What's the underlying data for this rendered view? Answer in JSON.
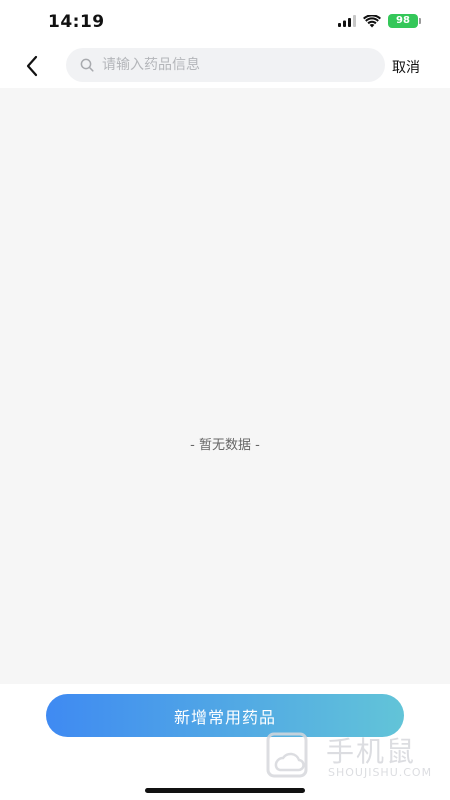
{
  "status_bar": {
    "time": "14:19",
    "battery_level": "98",
    "battery_color": "#34c759"
  },
  "search": {
    "placeholder": "请输入药品信息",
    "value": "",
    "cancel_label": "取消"
  },
  "icons": {
    "back": "chevron-left-icon",
    "search": "search-icon",
    "signal": "cellular-signal-icon",
    "wifi": "wifi-icon",
    "battery": "battery-charging-icon"
  },
  "content": {
    "empty_text": "- 暂无数据 -"
  },
  "bottom": {
    "add_button_label": "新增常用药品",
    "accent_gradient": [
      "#3f8af2",
      "#62c4d8"
    ]
  },
  "watermark": {
    "main": "手机鼠",
    "sub": "SHOUJISHU.COM"
  }
}
